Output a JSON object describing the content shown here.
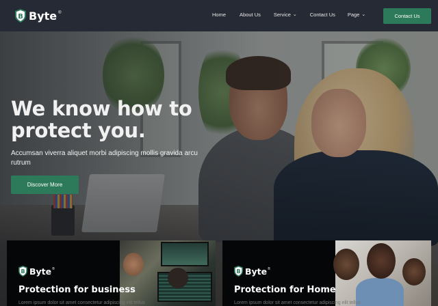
{
  "brand": {
    "name": "Byte",
    "mark": "B",
    "reg": "®",
    "accent": "#2d7a5a"
  },
  "nav": {
    "items": [
      {
        "label": "Home",
        "dropdown": false
      },
      {
        "label": "About Us",
        "dropdown": false
      },
      {
        "label": "Service",
        "dropdown": true
      },
      {
        "label": "Contact Us",
        "dropdown": false
      },
      {
        "label": "Page",
        "dropdown": true
      }
    ],
    "cta_label": "Contact Us"
  },
  "hero": {
    "title_line1": "We know how to",
    "title_line2": "protect you.",
    "subtitle": "Accumsan viverra aliquet morbi adipiscing mollis gravida arcu rutrum",
    "button_label": "Discover More"
  },
  "cards": [
    {
      "title": "Protection for business",
      "text": "Lorem ipsum dolor sit amet consectetur adipiscing elit tellus"
    },
    {
      "title": "Protection for Home",
      "text": "Lorem ipsum dolor sit amet consectetur adipiscing elit tellus"
    }
  ],
  "icons": {
    "logo": "shield-logo-icon",
    "dropdown": "chevron-down-icon"
  }
}
